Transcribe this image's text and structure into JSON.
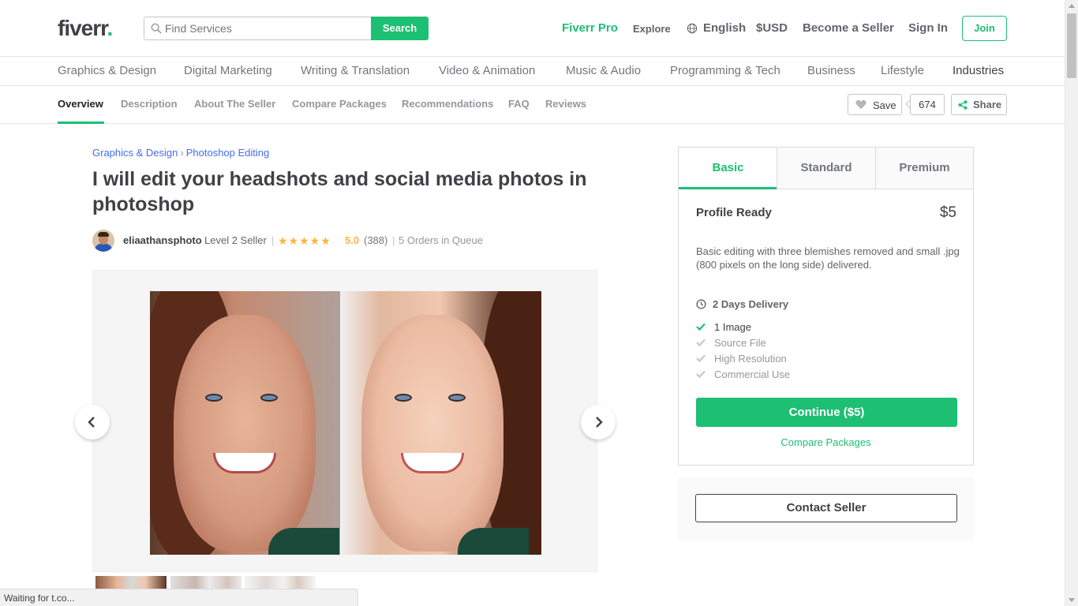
{
  "header": {
    "logo": "fiverr",
    "logo_dot": ".",
    "search_placeholder": "Find Services",
    "search_button": "Search",
    "nav": {
      "pro": "Fiverr Pro",
      "explore": "Explore",
      "language": "English",
      "currency": "$USD",
      "become_seller": "Become a Seller",
      "sign_in": "Sign In",
      "join": "Join"
    }
  },
  "categories": [
    "Graphics & Design",
    "Digital Marketing",
    "Writing & Translation",
    "Video & Animation",
    "Music & Audio",
    "Programming & Tech",
    "Business",
    "Lifestyle",
    "Industries"
  ],
  "subnav": {
    "items": [
      "Overview",
      "Description",
      "About The Seller",
      "Compare Packages",
      "Recommendations",
      "FAQ",
      "Reviews"
    ],
    "active": "Overview",
    "save_label": "Save",
    "save_count": "674",
    "share_label": "Share"
  },
  "gig": {
    "breadcrumb": [
      "Graphics & Design",
      "Photoshop Editing"
    ],
    "breadcrumb_sep": "›",
    "title": "I will edit your headshots and social media photos in photoshop",
    "seller_name": "eliaathansphoto",
    "seller_level": "Level 2 Seller",
    "stars": "★★★★★",
    "rating": "5.0",
    "review_count": "(388)",
    "queue": "5 Orders in Queue"
  },
  "package": {
    "tabs": [
      "Basic",
      "Standard",
      "Premium"
    ],
    "active_tab": "Basic",
    "name": "Profile Ready",
    "price": "$5",
    "description": "Basic editing with three blemishes removed and small .jpg (800 pixels on the long side) delivered.",
    "delivery": "2 Days Delivery",
    "features": [
      {
        "label": "1 Image",
        "included": true
      },
      {
        "label": "Source File",
        "included": false
      },
      {
        "label": "High Resolution",
        "included": false
      },
      {
        "label": "Commercial Use",
        "included": false
      }
    ],
    "continue_button": "Continue ($5)",
    "compare_link": "Compare Packages",
    "contact_button": "Contact Seller"
  },
  "status_bar": "Waiting for t.co...",
  "colors": {
    "brand_green": "#1dbf73",
    "link_blue": "#446ee7",
    "star_yellow": "#ffb33e"
  }
}
